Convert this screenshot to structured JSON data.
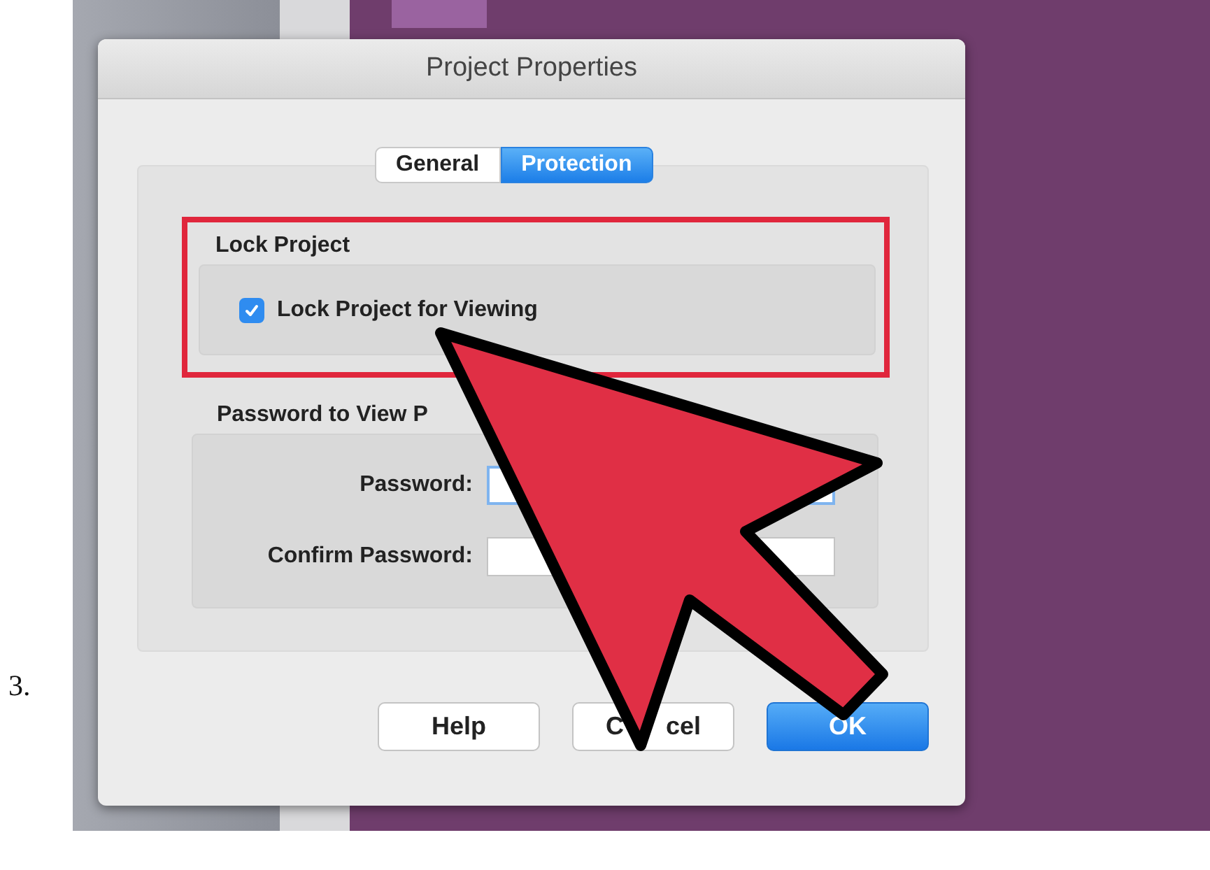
{
  "step": "3.",
  "dialog": {
    "title": "Project Properties",
    "tabs": [
      {
        "label": "General",
        "selected": false
      },
      {
        "label": "Protection",
        "selected": true
      }
    ],
    "lock_group": {
      "title": "Lock Project",
      "highlighted": true,
      "checkbox": {
        "label": "Lock Project for Viewing",
        "checked": true
      }
    },
    "password_group": {
      "title": "Password to View P",
      "fields": [
        {
          "label": "Password:",
          "focused": true
        },
        {
          "label": "Confirm Password:",
          "focused": false
        }
      ]
    },
    "buttons": [
      {
        "label": "Help",
        "default": false
      },
      {
        "label": "C",
        "label_end": "cel",
        "default": false
      },
      {
        "label": "OK",
        "default": true
      }
    ]
  }
}
